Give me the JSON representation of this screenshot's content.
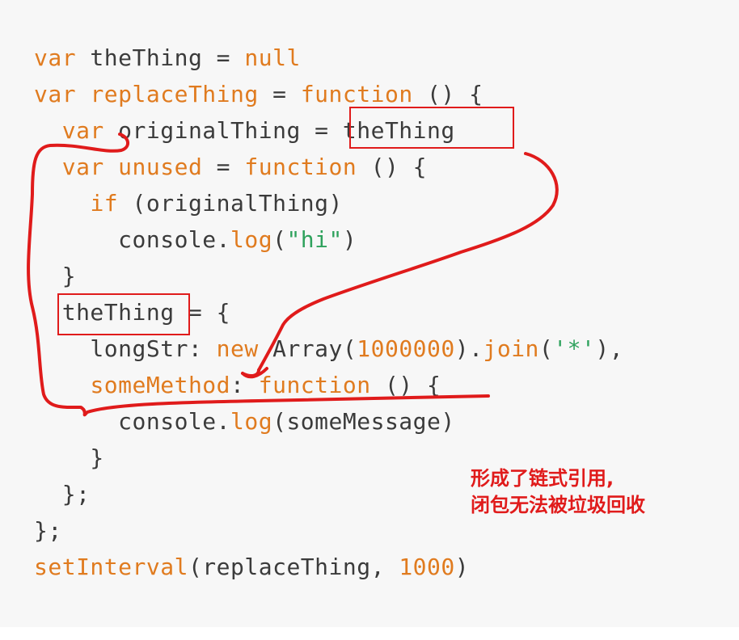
{
  "code": {
    "l1": [
      "var",
      " theThing = ",
      "null"
    ],
    "l2": [
      "var",
      " ",
      "replaceThing",
      " = ",
      "function",
      " () {"
    ],
    "l3": [
      "  ",
      "var",
      " originalThing = theThing"
    ],
    "l4": [
      "  ",
      "var",
      " ",
      "unused",
      " = ",
      "function",
      " () {"
    ],
    "l5": [
      "    ",
      "if",
      " (originalThing)"
    ],
    "l6": [
      "      console.",
      "log",
      "(",
      "\"hi\"",
      ")"
    ],
    "l7": [
      "  }"
    ],
    "l8": [
      "  theThing = {"
    ],
    "l9": [
      "    longStr: ",
      "new",
      " Array(",
      "1000000",
      ").",
      "join",
      "(",
      "'*'",
      "),"
    ],
    "l10": [
      "    ",
      "someMethod",
      ": ",
      "function",
      " () {"
    ],
    "l11": [
      "      console.",
      "log",
      "(someMessage)"
    ],
    "l12": [
      "    }"
    ],
    "l13": [
      "  };"
    ],
    "l14": [
      "};"
    ],
    "l15": [
      "setInterval",
      "(replaceThing, ",
      "1000",
      ")"
    ]
  },
  "annotation": {
    "line1": "形成了链式引用,",
    "line2": "闭包无法被垃圾回收"
  },
  "colors": {
    "background": "#f7f7f7",
    "keyword": "#e07b1f",
    "string": "#2fa25d",
    "text": "#3b3b3b",
    "annotation": "#e01b1b"
  }
}
